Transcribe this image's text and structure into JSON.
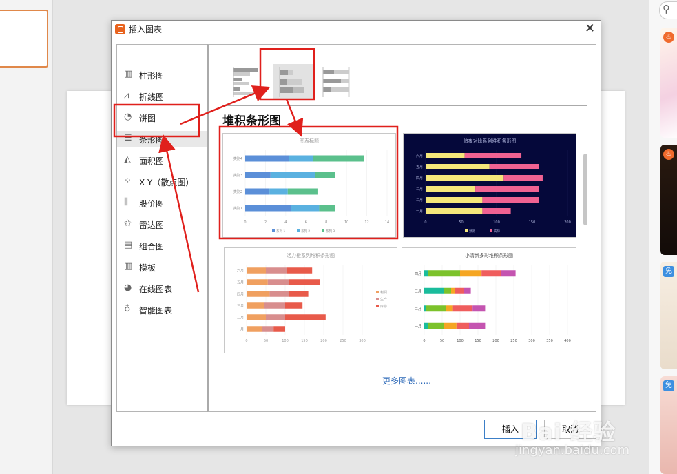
{
  "dialog": {
    "title": "插入图表",
    "close_glyph": "✕"
  },
  "categories": [
    {
      "label": "柱形图",
      "icon": "column-chart-icon"
    },
    {
      "label": "折线图",
      "icon": "line-chart-icon"
    },
    {
      "label": "饼图",
      "icon": "pie-chart-icon"
    },
    {
      "label": "条形图",
      "icon": "bar-chart-icon",
      "selected": true
    },
    {
      "label": "面积图",
      "icon": "area-chart-icon"
    },
    {
      "label": "X Y（散点图）",
      "icon": "scatter-chart-icon"
    },
    {
      "label": "股价图",
      "icon": "stock-chart-icon"
    },
    {
      "label": "雷达图",
      "icon": "radar-chart-icon"
    },
    {
      "label": "组合图",
      "icon": "combo-chart-icon"
    },
    {
      "label": "模板",
      "icon": "template-icon"
    },
    {
      "label": "在线图表",
      "icon": "online-chart-icon"
    },
    {
      "label": "智能图表",
      "icon": "smart-chart-icon"
    }
  ],
  "sub_types": [
    {
      "name": "clustered-bar"
    },
    {
      "name": "stacked-bar",
      "selected": true
    },
    {
      "name": "percent-stacked-bar"
    }
  ],
  "section_title": "堆积条形图",
  "more_link": "更多图表......",
  "buttons": {
    "insert": "插入",
    "cancel": "取消"
  },
  "watermark": {
    "logo": "Bai 经验",
    "url": "jingyan.baidu.com"
  },
  "annotation_color": "#e0201c",
  "thumbnails": [
    {
      "title": "图表标题",
      "bg": "#ffffff",
      "title_color": "#999999",
      "label_color": "#888888",
      "categories": [
        "类别4",
        "类别3",
        "类别2",
        "类别1"
      ],
      "ticks": [
        "0",
        "2",
        "4",
        "6",
        "8",
        "10",
        "12",
        "14"
      ],
      "xmax": 14,
      "colors": [
        "#5b8fd8",
        "#5ab1e0",
        "#5bc08c"
      ],
      "series": [
        [
          4.3,
          2.5,
          2.4,
          4.5
        ],
        [
          2.4,
          4.4,
          1.8,
          2.8
        ],
        [
          5.0,
          2.0,
          3.0,
          1.6
        ]
      ],
      "legend": [
        "系列 1",
        "系列 2",
        "系列 3"
      ],
      "legend_position": "bottom"
    },
    {
      "title": "暗夜对比系列堆积条形图",
      "bg": "#05083a",
      "title_color": "#aab0d8",
      "label_color": "#aab0d8",
      "categories": [
        "六月",
        "五月",
        "四月",
        "三月",
        "二月",
        "一月"
      ],
      "ticks": [
        "0",
        "50",
        "100",
        "150",
        "200"
      ],
      "xmax": 200,
      "colors": [
        "#f4e67a",
        "#f06292"
      ],
      "series": [
        [
          55,
          90,
          110,
          70,
          80,
          80
        ],
        [
          80,
          70,
          55,
          90,
          80,
          40
        ]
      ],
      "legend": [
        "预测",
        "实际"
      ],
      "legend_position": "bottom"
    },
    {
      "title": "活力橙系列堆积条形图",
      "bg": "#ffffff",
      "title_color": "#999999",
      "label_color": "#999999",
      "categories": [
        "六月",
        "五月",
        "四月",
        "三月",
        "二月",
        "一月"
      ],
      "ticks": [
        "0",
        "50",
        "100",
        "150",
        "200",
        "250",
        "300"
      ],
      "xmax": 300,
      "colors": [
        "#f0a060",
        "#d88e8e",
        "#e85a4a"
      ],
      "series": [
        [
          50,
          55,
          60,
          45,
          50,
          40
        ],
        [
          55,
          55,
          50,
          55,
          50,
          30
        ],
        [
          65,
          80,
          50,
          45,
          105,
          30
        ]
      ],
      "legend": [
        "利润",
        "生产",
        "库存"
      ],
      "legend_position": "right"
    },
    {
      "title": "小清新多彩堆积条形图",
      "bg": "#ffffff",
      "title_color": "#555555",
      "label_color": "#555555",
      "categories": [
        "四月",
        "三月",
        "二月",
        "一月"
      ],
      "ticks": [
        "0",
        "50",
        "100",
        "150",
        "200",
        "250",
        "300",
        "350",
        "400"
      ],
      "xmax": 400,
      "colors": [
        "#1abc9c",
        "#7cc22b",
        "#f5a623",
        "#ef5d5d",
        "#c454b0"
      ],
      "series": [
        [
          10,
          55,
          5,
          10,
          10
        ],
        [
          90,
          20,
          55,
          45,
          55
        ],
        [
          60,
          10,
          20,
          35,
          15
        ],
        [
          55,
          25,
          55,
          35,
          40
        ],
        [
          40,
          20,
          35,
          45,
          10
        ]
      ],
      "legend": [],
      "legend_position": "none"
    }
  ]
}
